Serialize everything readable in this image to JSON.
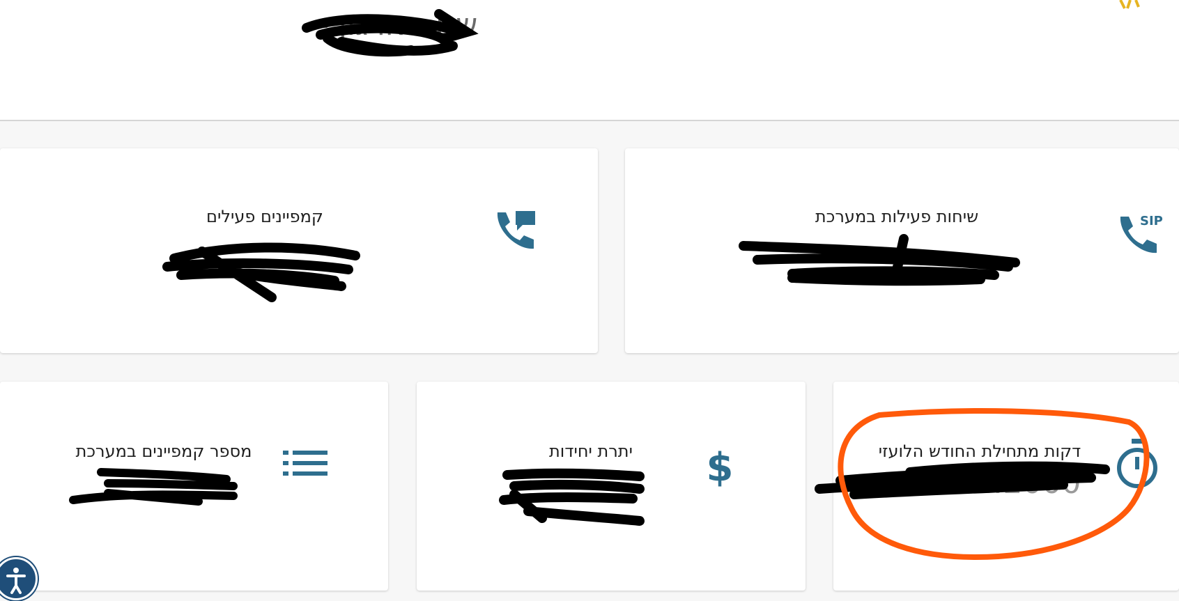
{
  "header": {
    "org_title": "שם הארגון -"
  },
  "cards": {
    "active_campaigns": {
      "title": "קמפיינים פעילים",
      "icon": "phone-chat-icon"
    },
    "active_calls": {
      "title": "שיחות פעילות במערכת",
      "icon": "sip-phone-icon"
    },
    "campaign_count": {
      "title": "מספר קמפיינים במערכת",
      "icon": "list-icon"
    },
    "units_balance": {
      "title": "יתרת יחידות",
      "icon": "dollar-icon"
    },
    "minutes": {
      "title": "דקות מתחילת החודש הלועזי",
      "value": "322:2000",
      "icon": "stopwatch-icon"
    }
  },
  "colors": {
    "icon": "#2e6e8e",
    "title_text": "#6b6b6b",
    "annotation": "#ff5a0a",
    "scribble": "#000000"
  },
  "accessibility": {
    "icon": "accessibility-icon"
  }
}
